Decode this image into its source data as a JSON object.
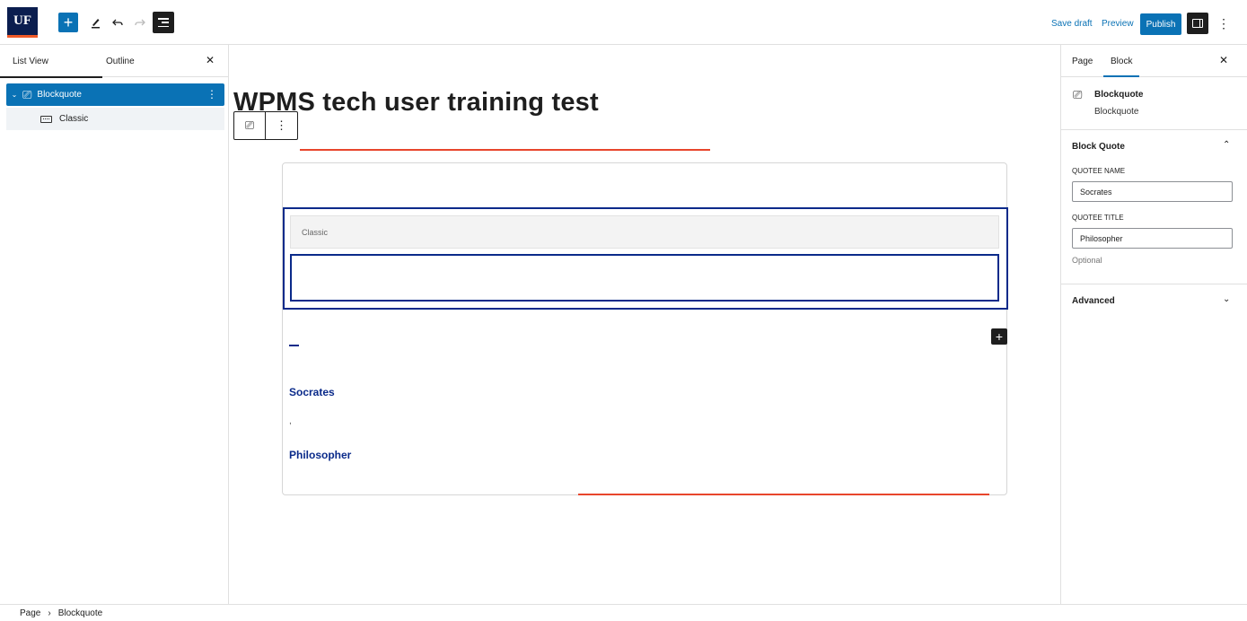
{
  "topbar": {
    "logo_text": "UF",
    "add_icon": "plus-icon",
    "tools_icon": "pencil-icon",
    "undo_icon": "undo-icon",
    "redo_icon": "redo-icon",
    "list_view_icon": "document-overview-icon",
    "save_draft": "Save draft",
    "preview": "Preview",
    "publish": "Publish",
    "settings_icon": "sidebar-toggle-icon",
    "options_icon": "vertical-ellipsis-icon",
    "accent_color": "#0a72b5",
    "logo_color": "#0b1e4f",
    "logo_stripe_color": "#f05a28"
  },
  "left_panel": {
    "tabs": [
      {
        "label": "List View"
      },
      {
        "label": "Outline"
      }
    ],
    "close_icon": "close-icon",
    "items": [
      {
        "label": "Blockquote",
        "icon": "blockquote-icon",
        "expanded": true,
        "selected": true
      },
      {
        "label": "Classic",
        "icon": "keyboard-icon",
        "selected": false
      }
    ]
  },
  "canvas": {
    "post_title": "WPMS tech user training test",
    "block_toolbar": {
      "block_icon": "blockquote-icon",
      "more_icon": "vertical-ellipsis-icon"
    },
    "classic_block": {
      "toolbar_label": "Classic"
    },
    "inserter_icon": "plus-icon",
    "quotee_name": "Socrates",
    "separator": ",",
    "quotee_title": "Philosopher",
    "highlight_color": "#e8452c",
    "quote_text_color": "#0a2a8a"
  },
  "right_panel": {
    "tabs": [
      {
        "label": "Page"
      },
      {
        "label": "Block"
      }
    ],
    "close_icon": "close-icon",
    "block_name": "Blockquote",
    "block_description": "Blockquote",
    "sections": {
      "block_quote": {
        "title": "Block Quote",
        "expanded": true,
        "fields": {
          "quotee_name_label": "QUOTEE NAME",
          "quotee_name_value": "Socrates",
          "quotee_title_label": "QUOTEE TITLE",
          "quotee_title_value": "Philosopher",
          "help": "Optional"
        }
      },
      "advanced": {
        "title": "Advanced",
        "expanded": false
      }
    }
  },
  "footer": {
    "breadcrumb": [
      "Page",
      "Blockquote"
    ],
    "separator_icon": "chevron-right-icon"
  }
}
